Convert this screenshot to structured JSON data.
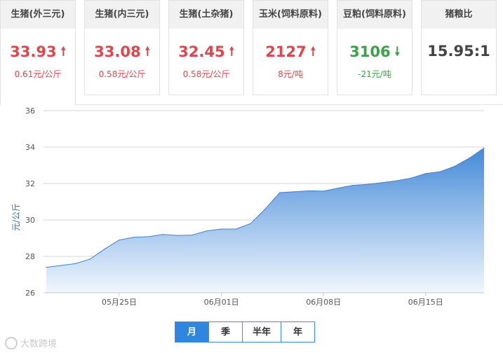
{
  "cards": [
    {
      "title": "生猪(外三元)",
      "price": "33.93",
      "change": "0.61元/公斤",
      "dir": "up",
      "icon": "arrow-up-icon"
    },
    {
      "title": "生猪(内三元)",
      "price": "33.08",
      "change": "0.58元/公斤",
      "dir": "up",
      "icon": "arrow-up-icon"
    },
    {
      "title": "生猪(土杂猪)",
      "price": "32.45",
      "change": "0.58元/公斤",
      "dir": "up",
      "icon": "arrow-up-icon"
    },
    {
      "title": "玉米(饲料原料)",
      "price": "2127",
      "change": "8元/吨",
      "dir": "up",
      "icon": "arrow-up-icon"
    },
    {
      "title": "豆粕(饲料原料)",
      "price": "3106",
      "change": "-21元/吨",
      "dir": "down",
      "icon": "arrow-down-icon"
    },
    {
      "title": "猪粮比",
      "price": "15.95:1",
      "change": "",
      "dir": "flat",
      "icon": ""
    }
  ],
  "tabs": [
    "月",
    "季",
    "半年",
    "年"
  ],
  "active_tab": "月",
  "watermark": "大数跨境",
  "colors": {
    "up": "#e0474c",
    "down": "#3aa147",
    "accent": "#2e86de",
    "area_top": "#3a83d6",
    "area_bottom": "#eef5fd"
  },
  "chart_data": {
    "type": "area",
    "ylabel": "元/公斤",
    "ylim": [
      26,
      36
    ],
    "yticks": [
      26,
      28,
      30,
      32,
      34,
      36
    ],
    "xlim": [
      "2019-05-20",
      "2019-06-19"
    ],
    "xticks": [
      {
        "date": "2019-05-25",
        "label": "05月25日"
      },
      {
        "date": "2019-06-01",
        "label": "06月01日"
      },
      {
        "date": "2019-06-08",
        "label": "06月08日"
      },
      {
        "date": "2019-06-15",
        "label": "06月15日"
      }
    ],
    "grid": true,
    "series": [
      {
        "x": [
          "2019-05-20",
          "2019-05-21",
          "2019-05-22",
          "2019-05-23",
          "2019-05-24",
          "2019-05-25",
          "2019-05-26",
          "2019-05-27",
          "2019-05-28",
          "2019-05-29",
          "2019-05-30",
          "2019-05-31",
          "2019-06-01",
          "2019-06-02",
          "2019-06-03",
          "2019-06-04",
          "2019-06-05",
          "2019-06-06",
          "2019-06-07",
          "2019-06-08",
          "2019-06-09",
          "2019-06-10",
          "2019-06-11",
          "2019-06-12",
          "2019-06-13",
          "2019-06-14",
          "2019-06-15",
          "2019-06-16",
          "2019-06-17",
          "2019-06-18",
          "2019-06-19"
        ],
        "values": [
          27.4,
          27.5,
          27.6,
          27.85,
          28.4,
          28.9,
          29.05,
          29.08,
          29.2,
          29.15,
          29.17,
          29.4,
          29.5,
          29.5,
          29.8,
          30.6,
          31.5,
          31.55,
          31.6,
          31.58,
          31.75,
          31.9,
          31.95,
          32.05,
          32.15,
          32.3,
          32.55,
          32.65,
          32.95,
          33.4,
          33.95
        ]
      }
    ]
  }
}
